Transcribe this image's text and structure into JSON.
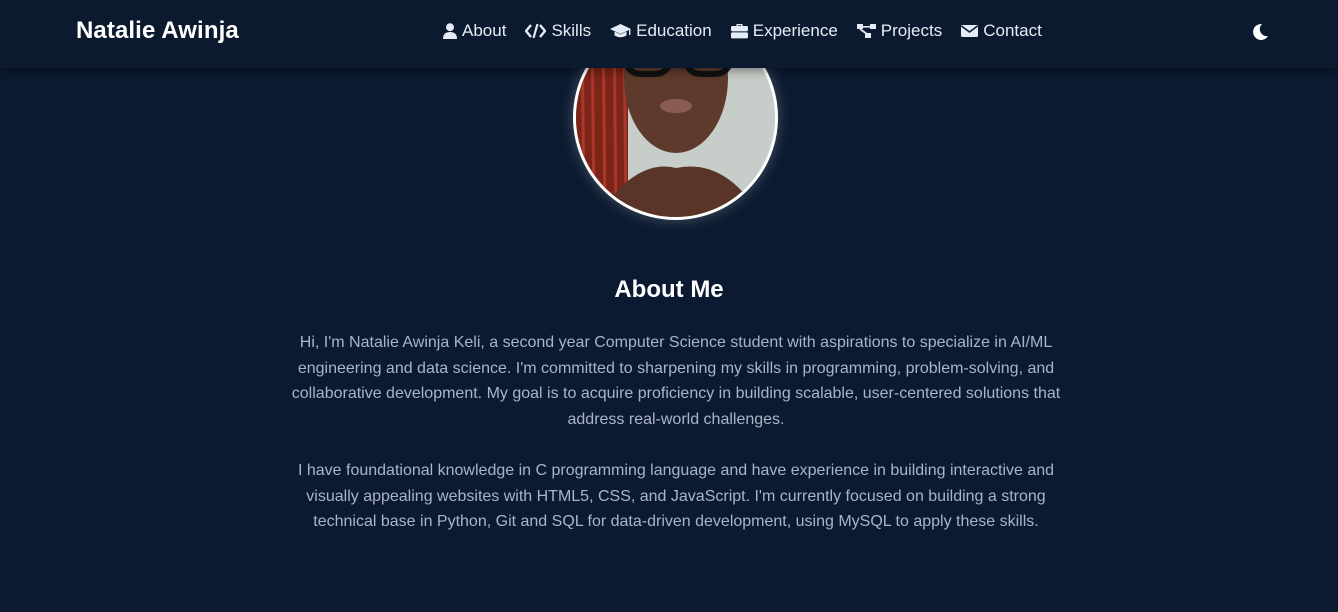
{
  "brand": {
    "name": "Natalie Awinja"
  },
  "nav": {
    "items": [
      {
        "label": "About",
        "icon": "user-icon"
      },
      {
        "label": "Skills",
        "icon": "code-icon"
      },
      {
        "label": "Education",
        "icon": "graduation-cap-icon"
      },
      {
        "label": "Experience",
        "icon": "briefcase-icon"
      },
      {
        "label": "Projects",
        "icon": "project-diagram-icon"
      },
      {
        "label": "Contact",
        "icon": "envelope-icon"
      }
    ],
    "theme_toggle_icon": "moon-icon"
  },
  "profile": {
    "photo_icon": "profile-photo"
  },
  "about": {
    "title": "About Me",
    "paragraphs": [
      "Hi, I'm Natalie Awinja Keli, a second year Computer Science student with aspirations to specialize in AI/ML engineering and data science. I'm committed to sharpening my skills in programming, problem-solving, and collaborative development. My goal is to acquire proficiency in building scalable, user-centered solutions that address real-world challenges.",
      "I have foundational knowledge in C programming language and have experience in building interactive and visually appealing websites with HTML5, CSS, and JavaScript. I'm currently focused on building a strong technical base in Python, Git and SQL for data-driven development, using MySQL to apply these skills."
    ]
  },
  "colors": {
    "background": "#0b1a30",
    "navbar": "#0b1a2e",
    "heading": "#ffffff",
    "body_text": "#a9b4c8"
  }
}
